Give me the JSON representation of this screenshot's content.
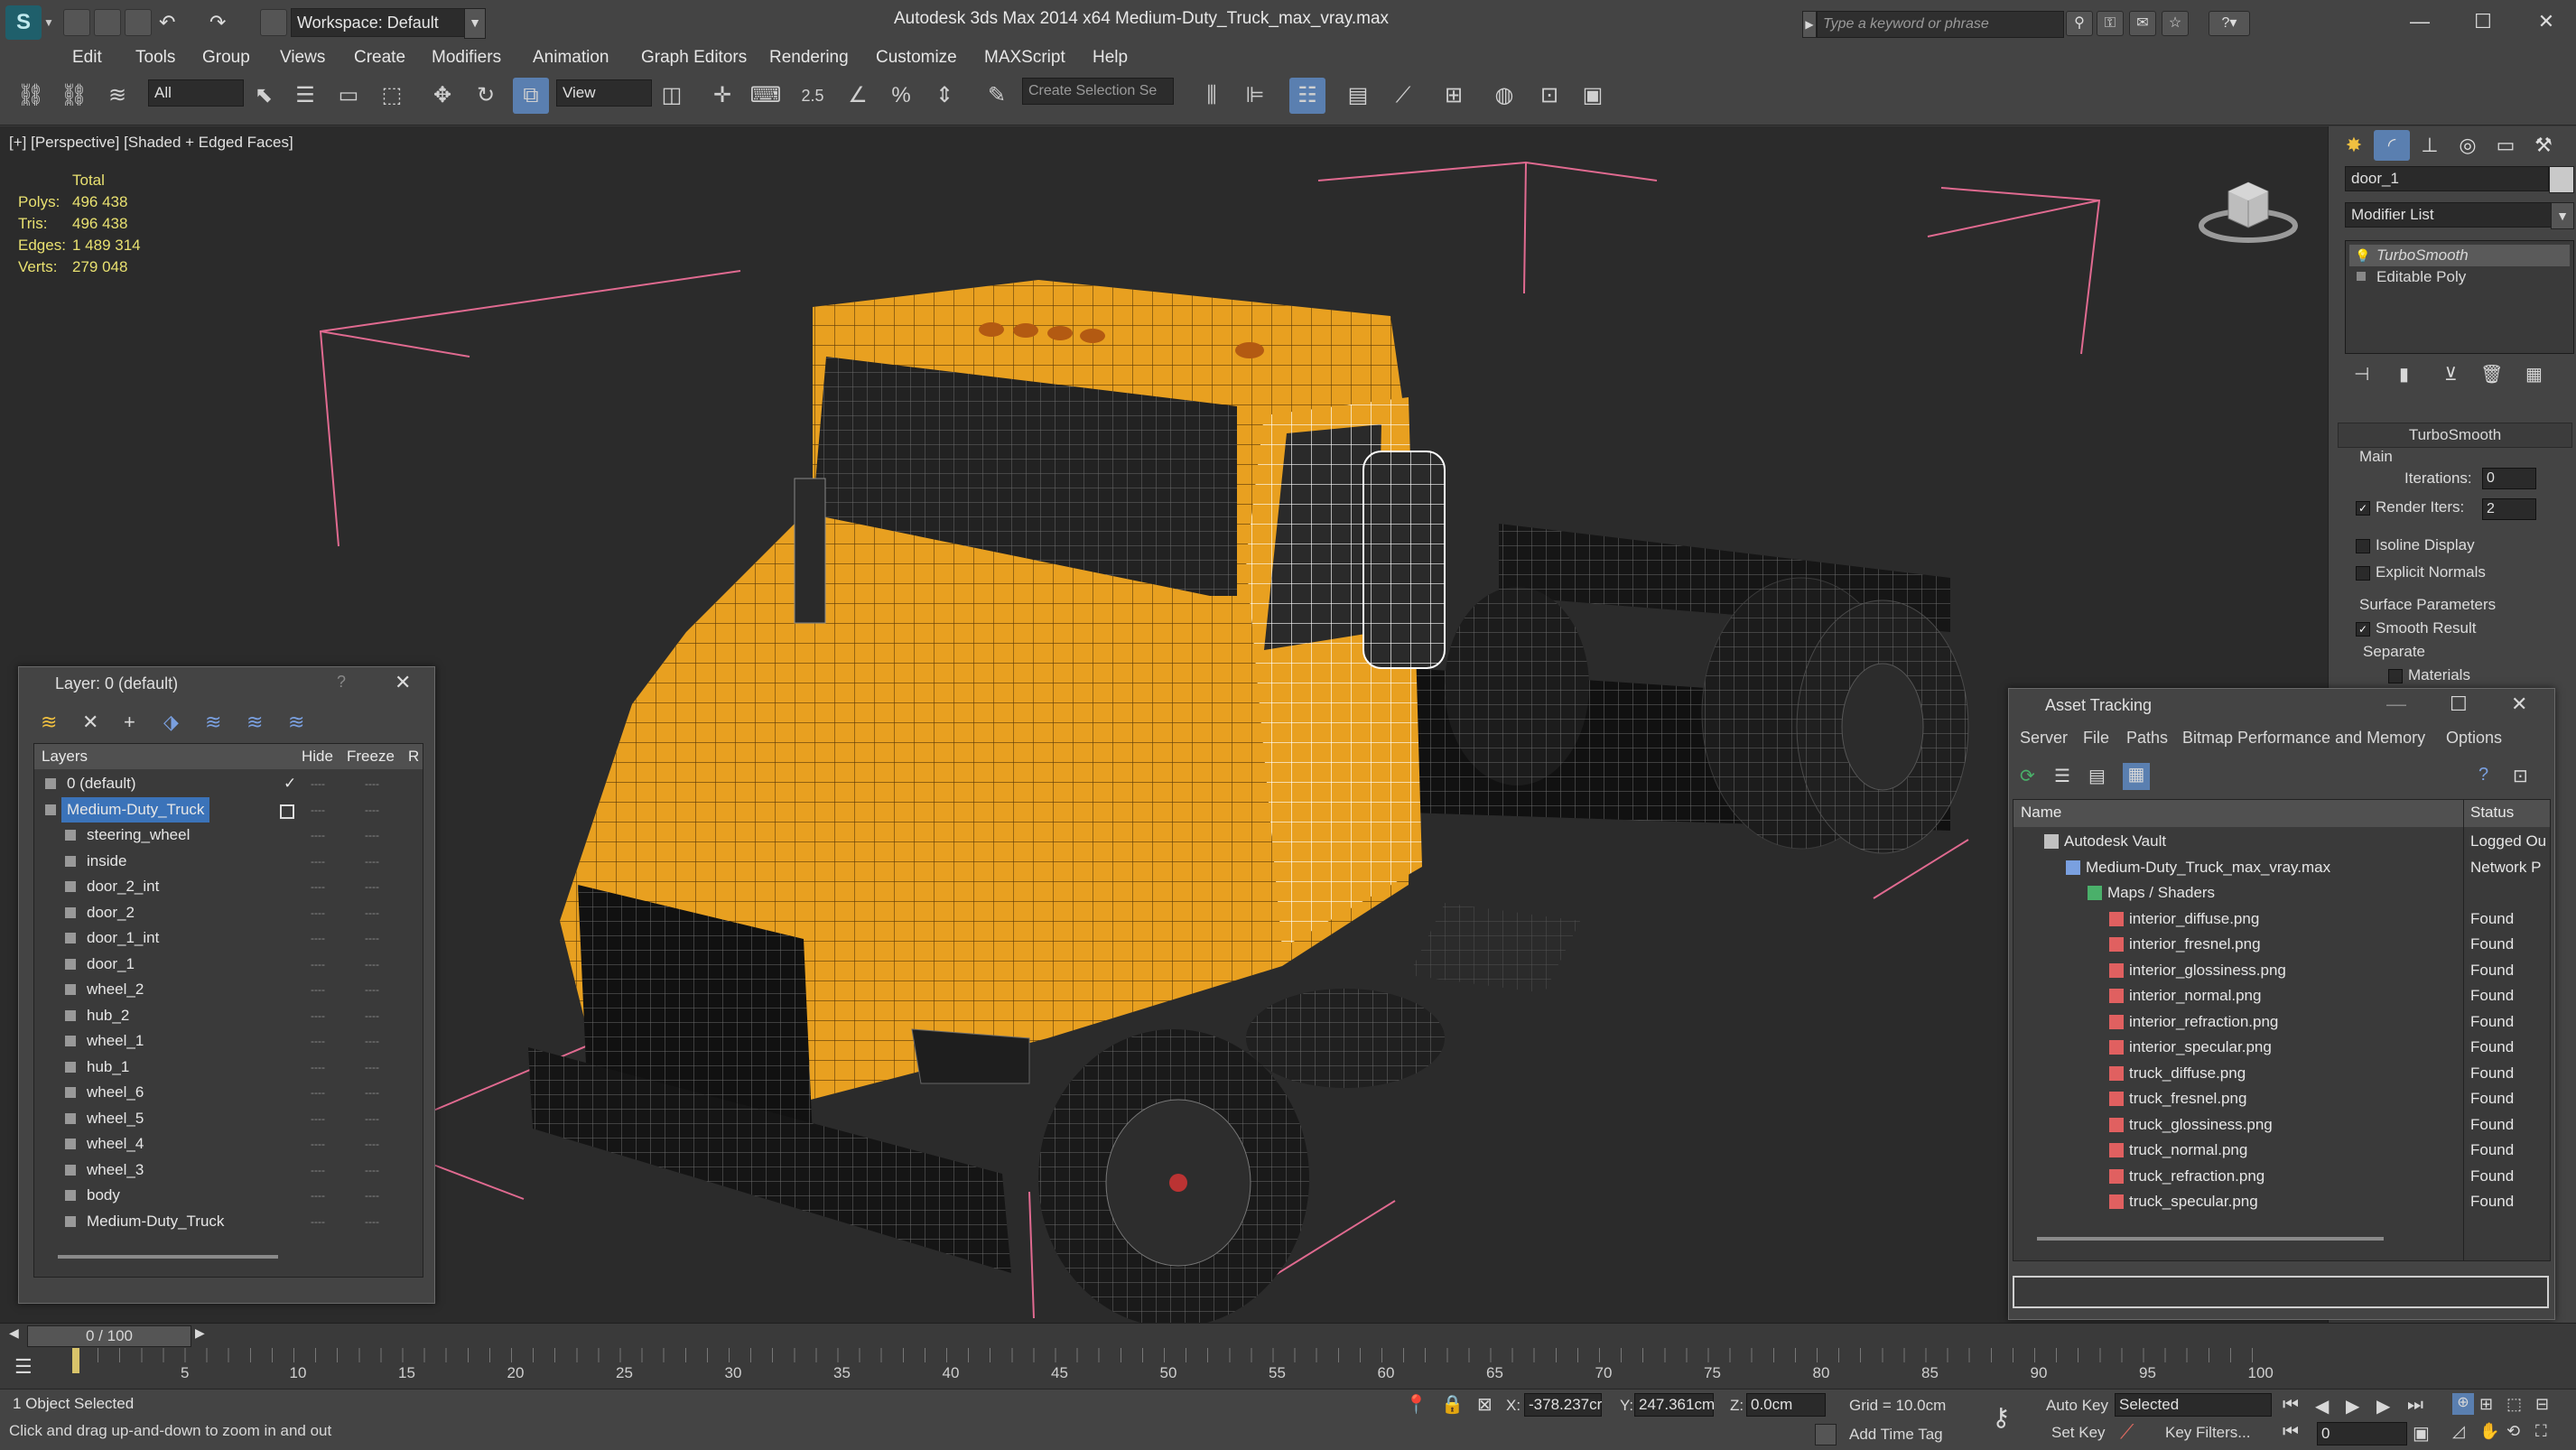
{
  "title_bar": {
    "workspace_label": "Workspace: Default",
    "app_title": "Autodesk 3ds Max  2014 x64      Medium-Duty_Truck_max_vray.max",
    "search_placeholder": "Type a keyword or phrase"
  },
  "menu": [
    "Edit",
    "Tools",
    "Group",
    "Views",
    "Create",
    "Modifiers",
    "Animation",
    "Graph Editors",
    "Rendering",
    "Customize",
    "MAXScript",
    "Help"
  ],
  "toolbar": {
    "filter_value": "All",
    "ref_coord_value": "View",
    "snap_value": "2.5",
    "selection_set_placeholder": "Create Selection Se"
  },
  "viewport": {
    "label": "[+] [Perspective] [Shaded + Edged Faces]",
    "stats": {
      "header": "Total",
      "polys_label": "Polys:",
      "polys": "496 438",
      "tris_label": "Tris:",
      "tris": "496 438",
      "edges_label": "Edges:",
      "edges": "1 489 314",
      "verts_label": "Verts:",
      "verts": "279 048"
    },
    "model_color": "#e8a020"
  },
  "command_panel": {
    "object_name": "door_1",
    "modifier_list": "Modifier List",
    "stack": [
      "TurboSmooth",
      "Editable Poly"
    ],
    "rollout_title": "TurboSmooth",
    "main_label": "Main",
    "iterations_label": "Iterations:",
    "iterations_value": "0",
    "render_iters_label": "Render Iters:",
    "render_iters_value": "2",
    "isoline_label": "Isoline Display",
    "explicit_normals_label": "Explicit Normals",
    "surface_params_label": "Surface Parameters",
    "smooth_result_label": "Smooth Result",
    "separate_label": "Separate",
    "materials_label": "Materials"
  },
  "layer_dialog": {
    "title": "Layer: 0 (default)",
    "help": "?",
    "col_layers": "Layers",
    "col_hide": "Hide",
    "col_freeze": "Freeze",
    "col_r": "R",
    "rows": [
      {
        "name": "0 (default)",
        "indent": 0
      },
      {
        "name": "Medium-Duty_Truck",
        "indent": 0
      },
      {
        "name": "steering_wheel",
        "indent": 1
      },
      {
        "name": "inside",
        "indent": 1
      },
      {
        "name": "door_2_int",
        "indent": 1
      },
      {
        "name": "door_2",
        "indent": 1
      },
      {
        "name": "door_1_int",
        "indent": 1
      },
      {
        "name": "door_1",
        "indent": 1
      },
      {
        "name": "wheel_2",
        "indent": 1
      },
      {
        "name": "hub_2",
        "indent": 1
      },
      {
        "name": "wheel_1",
        "indent": 1
      },
      {
        "name": "hub_1",
        "indent": 1
      },
      {
        "name": "wheel_6",
        "indent": 1
      },
      {
        "name": "wheel_5",
        "indent": 1
      },
      {
        "name": "wheel_4",
        "indent": 1
      },
      {
        "name": "wheel_3",
        "indent": 1
      },
      {
        "name": "body",
        "indent": 1
      },
      {
        "name": "Medium-Duty_Truck",
        "indent": 1
      }
    ],
    "hide_dash": "----",
    "freeze_dash": "----"
  },
  "asset_dialog": {
    "title": "Asset Tracking",
    "menu": [
      "Server",
      "File",
      "Paths",
      "Bitmap Performance and Memory",
      "Options"
    ],
    "col_name": "Name",
    "col_status": "Status",
    "rows": [
      {
        "name": "Autodesk Vault",
        "status": "Logged Ou",
        "indent": 1,
        "icon": "vault"
      },
      {
        "name": "Medium-Duty_Truck_max_vray.max",
        "status": "Network P",
        "indent": 2,
        "icon": "max"
      },
      {
        "name": "Maps / Shaders",
        "status": "",
        "indent": 3,
        "icon": "maps"
      },
      {
        "name": "interior_diffuse.png",
        "status": "Found",
        "indent": 4,
        "icon": "png"
      },
      {
        "name": "interior_fresnel.png",
        "status": "Found",
        "indent": 4,
        "icon": "png"
      },
      {
        "name": "interior_glossiness.png",
        "status": "Found",
        "indent": 4,
        "icon": "png"
      },
      {
        "name": "interior_normal.png",
        "status": "Found",
        "indent": 4,
        "icon": "png"
      },
      {
        "name": "interior_refraction.png",
        "status": "Found",
        "indent": 4,
        "icon": "png"
      },
      {
        "name": "interior_specular.png",
        "status": "Found",
        "indent": 4,
        "icon": "png"
      },
      {
        "name": "truck_diffuse.png",
        "status": "Found",
        "indent": 4,
        "icon": "png"
      },
      {
        "name": "truck_fresnel.png",
        "status": "Found",
        "indent": 4,
        "icon": "png"
      },
      {
        "name": "truck_glossiness.png",
        "status": "Found",
        "indent": 4,
        "icon": "png"
      },
      {
        "name": "truck_normal.png",
        "status": "Found",
        "indent": 4,
        "icon": "png"
      },
      {
        "name": "truck_refraction.png",
        "status": "Found",
        "indent": 4,
        "icon": "png"
      },
      {
        "name": "truck_specular.png",
        "status": "Found",
        "indent": 4,
        "icon": "png"
      }
    ]
  },
  "timeline": {
    "frame_display": "0 / 100",
    "ticks": [
      "5",
      "10",
      "15",
      "20",
      "25",
      "30",
      "35",
      "40",
      "45",
      "50",
      "55",
      "60",
      "65",
      "70",
      "75",
      "80",
      "85",
      "90",
      "95",
      "100"
    ]
  },
  "status": {
    "selection": "1 Object Selected",
    "prompt": "Click and drag up-and-down to zoom in and out",
    "x_label": "X:",
    "x_value": "-378.237cr",
    "y_label": "Y:",
    "y_value": "247.361cm",
    "z_label": "Z:",
    "z_value": "0.0cm",
    "grid": "Grid = 10.0cm",
    "add_time_tag": "Add Time Tag",
    "auto_key": "Auto Key",
    "set_key": "Set Key",
    "key_mode_value": "Selected",
    "key_filters": "Key Filters...",
    "frame_value": "0"
  }
}
